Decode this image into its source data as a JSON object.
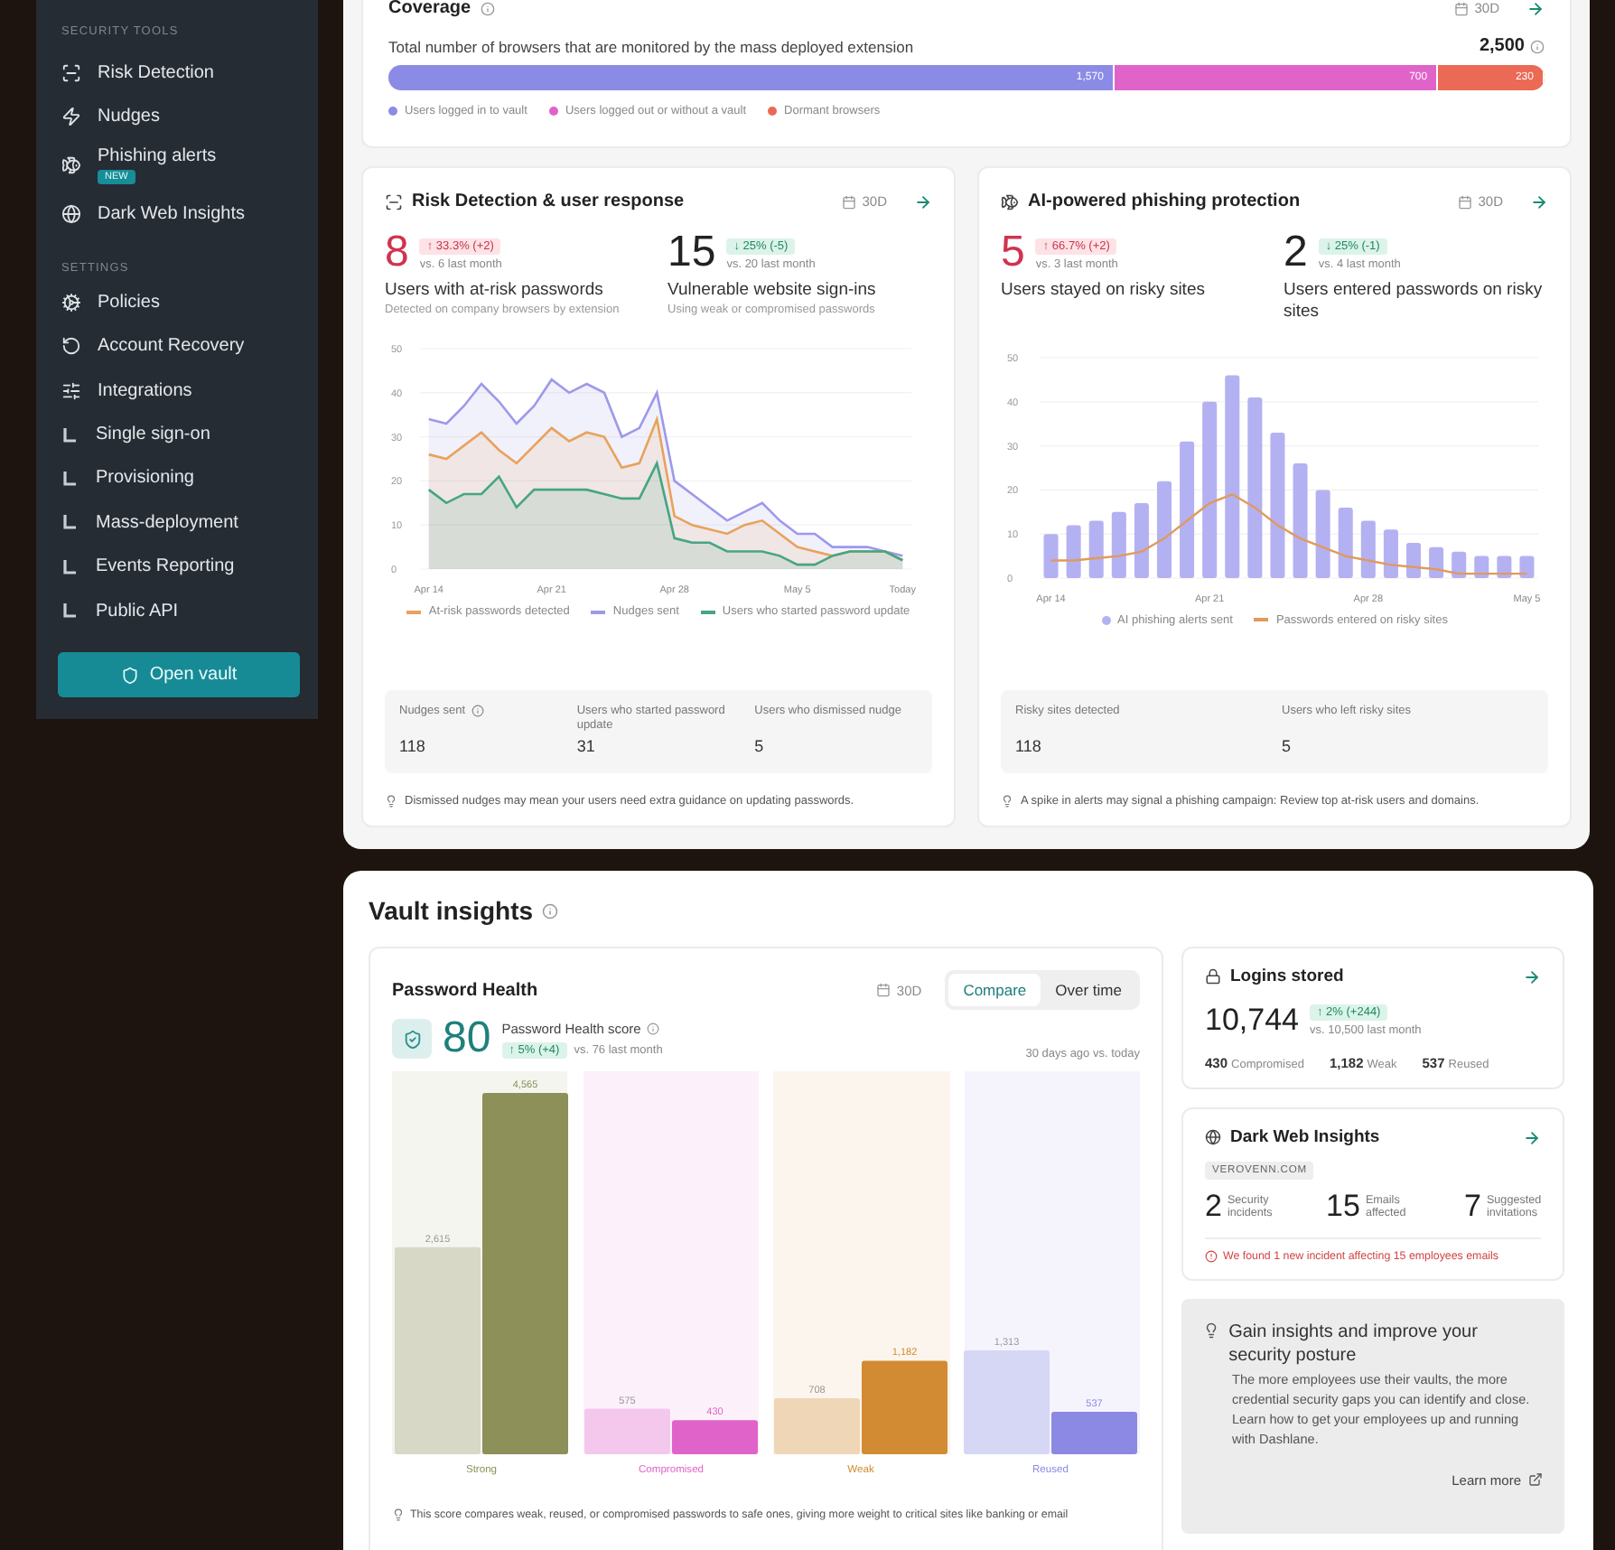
{
  "sidebar": {
    "sections": [
      {
        "title": "SECURITY TOOLS",
        "items": [
          {
            "label": "Risk Detection"
          },
          {
            "label": "Nudges"
          },
          {
            "label": "Phishing alerts",
            "badge": "NEW"
          },
          {
            "label": "Dark Web Insights"
          }
        ]
      },
      {
        "title": "SETTINGS",
        "items": [
          {
            "label": "Policies"
          },
          {
            "label": "Account Recovery"
          },
          {
            "label": "Integrations",
            "children": [
              {
                "label": "Single sign-on"
              },
              {
                "label": "Provisioning"
              },
              {
                "label": "Mass-deployment"
              },
              {
                "label": "Events Reporting"
              },
              {
                "label": "Public API"
              }
            ]
          }
        ]
      }
    ],
    "button": "Open vault"
  },
  "coverage": {
    "title": "Coverage",
    "period": "30D",
    "description": "Total number of browsers that are monitored by the mass deployed extension",
    "total": "2,500",
    "segments": [
      {
        "label": "Users logged in to vault",
        "value": "1,570",
        "color": "#8b8be6"
      },
      {
        "label": "Users logged out or without a vault",
        "value": "700",
        "color": "#e063c9"
      },
      {
        "label": "Dormant browsers",
        "value": "230",
        "color": "#ea6a55"
      }
    ]
  },
  "risk_card": {
    "title": "Risk Detection & user response",
    "period": "30D",
    "metrics": [
      {
        "value": "8",
        "alert": true,
        "badge": {
          "text": "↑ 33.3% (+2)",
          "alert": true
        },
        "comparison": "vs. 6 last month",
        "label": "Users with at-risk passwords",
        "sublabel": "Detected on company browsers by extension"
      },
      {
        "value": "15",
        "alert": false,
        "badge": {
          "text": "↓ 25% (-5)",
          "alert": false
        },
        "comparison": "vs. 20 last month",
        "label": "Vulnerable website sign-ins",
        "sublabel": "Using weak or compromised passwords"
      }
    ],
    "chart_data": {
      "type": "area",
      "grid": true,
      "legend": "bottom",
      "categories": [
        "Apr 14",
        null,
        null,
        null,
        null,
        null,
        null,
        "Apr 21",
        null,
        null,
        null,
        null,
        null,
        null,
        "Apr 28",
        null,
        null,
        null,
        null,
        null,
        null,
        "May 5",
        null,
        null,
        null,
        null,
        null,
        "Today"
      ],
      "ylim": [
        0,
        50
      ],
      "yticks": [
        0,
        10,
        20,
        30,
        40,
        50
      ],
      "series": [
        {
          "name": "At-risk passwords detected",
          "color": "#e8a25c",
          "values": [
            26,
            25,
            28,
            31,
            27,
            24,
            28,
            32,
            29,
            31,
            30,
            23,
            24,
            34,
            12,
            10,
            9,
            8,
            10,
            11,
            8,
            5,
            4,
            3,
            4,
            4,
            4,
            2
          ]
        },
        {
          "name": "Nudges sent",
          "color": "#9d99ea",
          "values": [
            34,
            33,
            37,
            42,
            38,
            33,
            37,
            43,
            40,
            42,
            40,
            30,
            32,
            40,
            20,
            17,
            14,
            11,
            13,
            15,
            11,
            8,
            8,
            5,
            5,
            5,
            4,
            3
          ]
        },
        {
          "name": "Users who started password update",
          "color": "#45a585",
          "values": [
            18,
            15,
            17,
            17,
            21,
            14,
            18,
            18,
            18,
            18,
            17,
            16,
            16,
            24,
            7,
            6,
            6,
            4,
            4,
            4,
            3,
            1,
            1,
            3,
            4,
            4,
            4,
            2
          ]
        }
      ]
    },
    "stats": [
      {
        "label": "Nudges sent",
        "info": true,
        "value": "118"
      },
      {
        "label": "Users who started password update",
        "info": false,
        "value": "31"
      },
      {
        "label": "Users who dismissed nudge",
        "info": false,
        "value": "5"
      }
    ],
    "note": "Dismissed nudges may mean your users need extra guidance on updating passwords."
  },
  "phishing_card": {
    "title": "AI-powered phishing protection",
    "period": "30D",
    "metrics": [
      {
        "value": "5",
        "alert": true,
        "badge": {
          "text": "↑ 66.7% (+2)",
          "alert": true
        },
        "comparison": "vs. 3 last month",
        "label": "Users stayed on risky sites"
      },
      {
        "value": "2",
        "alert": false,
        "badge": {
          "text": "↓ 25% (-1)",
          "alert": false
        },
        "comparison": "vs. 4 last month",
        "label": "Users entered passwords on risky sites"
      }
    ],
    "chart_data": {
      "type": "bar",
      "grid": true,
      "legend": "bottom",
      "categories": [
        "Apr 14",
        null,
        null,
        null,
        null,
        null,
        null,
        "Apr 21",
        null,
        null,
        null,
        null,
        null,
        null,
        "Apr 28",
        null,
        null,
        null,
        null,
        null,
        null,
        "May 5"
      ],
      "ylim": [
        0,
        50
      ],
      "yticks": [
        0,
        10,
        20,
        30,
        40,
        50
      ],
      "series": [
        {
          "name": "AI phishing alerts sent",
          "type": "bar",
          "color": "#b4b1f2",
          "values": [
            10,
            12,
            13,
            15,
            17,
            22,
            31,
            40,
            46,
            41,
            33,
            26,
            20,
            16,
            13,
            11,
            8,
            7,
            6,
            5,
            5,
            5
          ]
        },
        {
          "name": "Passwords entered on risky sites",
          "type": "line",
          "color": "#e09a5c",
          "values": [
            4,
            4,
            4.5,
            5,
            6,
            9,
            13,
            17,
            19,
            16,
            12,
            9,
            7,
            5,
            4,
            3,
            2.5,
            2,
            1,
            1,
            1,
            1
          ]
        }
      ]
    },
    "stats": [
      {
        "label": "Risky sites detected",
        "info": false,
        "value": "118"
      },
      {
        "label": "Users who left risky sites",
        "info": false,
        "value": "5"
      }
    ],
    "note": "A spike in alerts may signal a phishing campaign: Review top at-risk users and domains."
  },
  "vault_insights": {
    "title": "Vault insights",
    "password_health": {
      "title": "Password Health",
      "period": "30D",
      "tabs": [
        {
          "label": "Compare",
          "selected": true
        },
        {
          "label": "Over time",
          "selected": false
        }
      ],
      "score": "80",
      "score_label": "Password Health score",
      "badge": {
        "text": "↑ 5% (+4)",
        "alert": false
      },
      "comparison": "vs. 76 last month",
      "range": "30 days ago vs. today",
      "chart_data": {
        "type": "bar",
        "categories": [
          "Strong",
          "Compromised",
          "Weak",
          "Reused"
        ],
        "series": [
          {
            "colors": [
              "#d7d8c5",
              "#f4c8ec",
              "#efd6b7",
              "#d6d6f5"
            ],
            "values": [
              2615,
              575,
              708,
              1313
            ],
            "value_labels": [
              "2,615",
              "575",
              "708",
              "1,313"
            ]
          },
          {
            "colors": [
              "#8d9058",
              "#e063c9",
              "#d28b32",
              "#8b89e3"
            ],
            "values": [
              4565,
              430,
              1182,
              537
            ],
            "value_labels": [
              "4,565",
              "430",
              "1,182",
              "537"
            ]
          }
        ]
      },
      "note": "This score compares weak, reused, or compromised passwords to safe ones, giving more weight to critical sites like banking or email"
    },
    "logins": {
      "title": "Logins stored",
      "value": "10,744",
      "badge": {
        "text": "↑ 2% (+244)",
        "alert": false
      },
      "comparison": "vs. 10,500 last month",
      "breakdown": [
        {
          "value": "430",
          "label": "Compromised"
        },
        {
          "value": "1,182",
          "label": "Weak"
        },
        {
          "value": "537",
          "label": "Reused"
        }
      ]
    },
    "dark_web": {
      "title": "Dark Web Insights",
      "domain": "VEROVENN.COM",
      "stats": [
        {
          "value": "2",
          "label": "Security incidents"
        },
        {
          "value": "15",
          "label": "Emails affected"
        },
        {
          "value": "7",
          "label": "Suggested invitations"
        }
      ],
      "alert": "We found 1 new incident affecting 15 employees emails"
    },
    "tip": {
      "title": "Gain insights and improve your security posture",
      "body": "The more employees use their vaults, the more credential security gaps you can identify and close. Learn how to get your employees up and running with Dashlane.",
      "link": "Learn more"
    }
  }
}
